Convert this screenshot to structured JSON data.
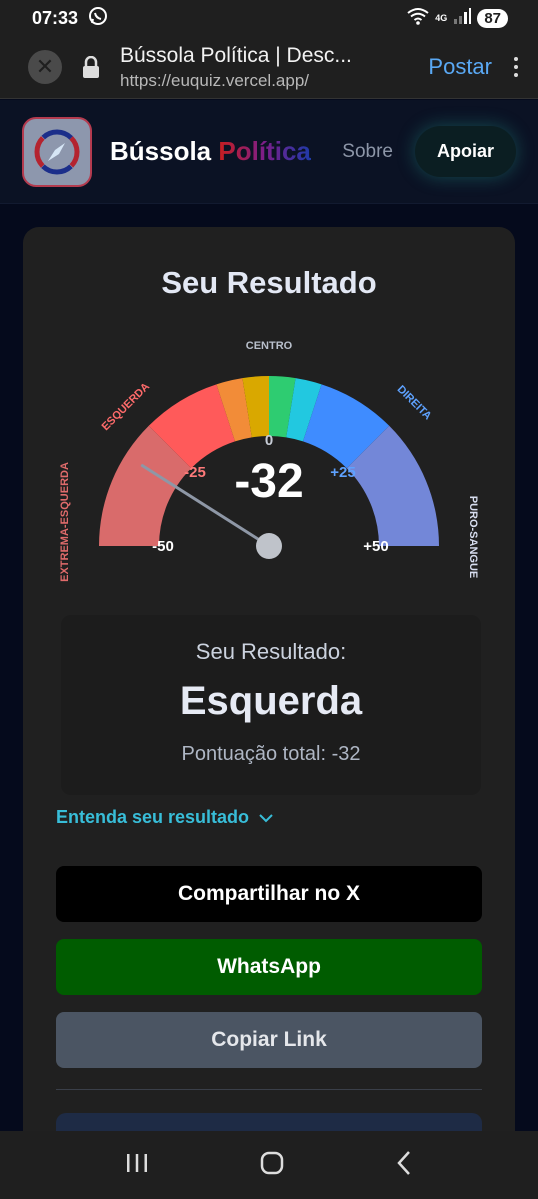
{
  "status_bar": {
    "time": "07:33",
    "network": "4G",
    "battery": "87",
    "icons": [
      "whatsapp-icon",
      "wifi-icon",
      "signal-icon",
      "battery-icon"
    ]
  },
  "browser": {
    "page_title": "Bússola Política | Desc...",
    "url": "https://euquiz.vercel.app/",
    "post_label": "Postar",
    "icons": [
      "close-icon",
      "lock-icon",
      "more-vert-icon"
    ]
  },
  "site_header": {
    "brand_word1": "Bússola",
    "brand_word2": "Política",
    "nav_about": "Sobre",
    "support_button": "Apoiar",
    "logo_icon": "compass-icon"
  },
  "result_card": {
    "title": "Seu Resultado",
    "gauge": {
      "score": "-32",
      "value": -32,
      "range": [
        -50,
        50
      ],
      "labels": {
        "top": "CENTRO",
        "left": "ESQUERDA",
        "right": "DIREITA",
        "far_left": "EXTREMA-ESQUERDA",
        "far_right": "PURO-SANGUE"
      },
      "ticks": [
        "-50",
        "-25",
        "0",
        "+25",
        "+50"
      ],
      "colors": {
        "far_left": "#d96b6b",
        "left": "#ff5a5a",
        "center_left_1": "#f28c38",
        "center_left_2": "#d9a800",
        "center_right_1": "#2ecc71",
        "center_right_2": "#22c8e0",
        "right": "#3f8cff",
        "far_right": "#7387d8"
      }
    },
    "result_label": "Seu Resultado:",
    "result_value": "Esquerda",
    "total_score": "Pontuação total: -32",
    "understand_link": "Entenda seu resultado",
    "share_x": "Compartilhar no X",
    "share_whatsapp": "WhatsApp",
    "copy_link": "Copiar Link"
  },
  "nav_bar": {
    "icons": [
      "recents-icon",
      "home-icon",
      "back-icon"
    ]
  }
}
